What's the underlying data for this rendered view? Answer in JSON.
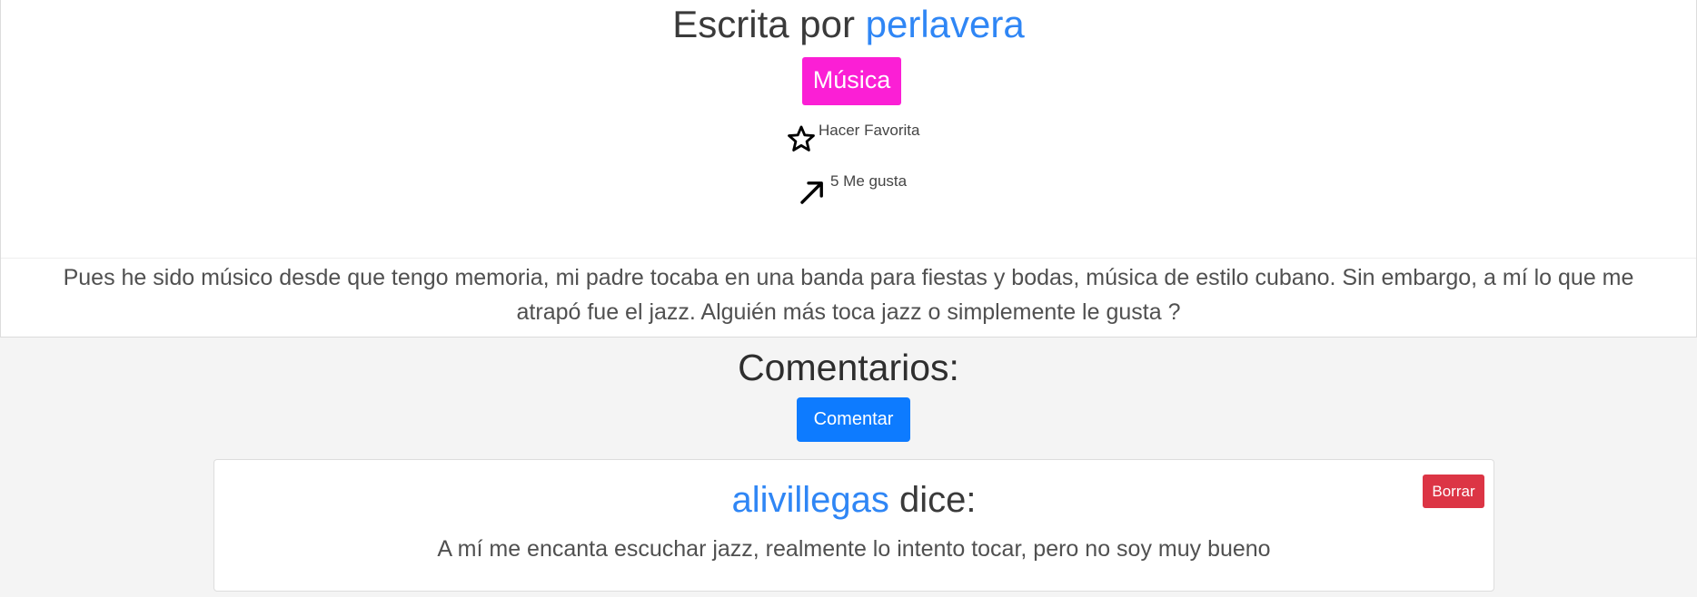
{
  "post": {
    "title_prefix": "Escrita por",
    "author": "perlavera",
    "category": "Música",
    "favorite_label": "Hacer Favorita",
    "likes_label": "5 Me gusta",
    "body": "Pues he sido músico desde que tengo memoria, mi padre tocaba en una banda para fiestas y bodas, música de estilo cubano. Sin embargo, a mí lo que me atrapó fue el jazz. Alguién más toca jazz o simplemente le gusta ?"
  },
  "comments": {
    "title": "Comentarios:",
    "add_button_label": "Comentar",
    "items": [
      {
        "author": "alivillegas",
        "says": "dice:",
        "text": "A mí me encanta escuchar jazz, realmente lo intento tocar, pero no soy muy bueno",
        "delete_label": "Borrar"
      }
    ]
  },
  "icons": {
    "favorite": "star-outline-icon",
    "like": "arrow-up-right-icon"
  },
  "colors": {
    "link": "#2f86f5",
    "category_badge": "#fb1fd5",
    "primary_button": "#0d7bff",
    "danger_button": "#dc3545",
    "page_background": "#f4f4f4"
  }
}
